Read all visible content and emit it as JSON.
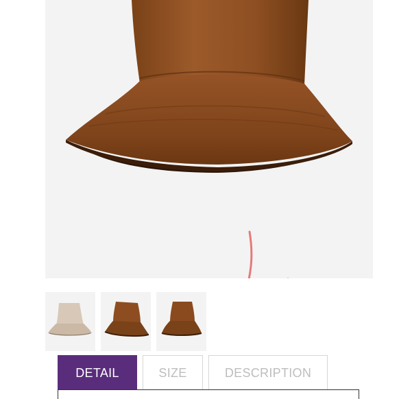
{
  "product": {
    "main_image": "brown-suede-bucket-hat",
    "handwritten_mark": "L",
    "mark_color": "#e57a7a",
    "thumbnails": [
      {
        "icon": "beige-bucket-hat"
      },
      {
        "icon": "brown-suede-bucket-hat"
      },
      {
        "icon": "brown-suede-bucket-hat"
      }
    ]
  },
  "tabs": {
    "detail_label": "DETAIL",
    "size_label": "SIZE",
    "description_label": "DESCRIPTION",
    "active_color": "#5a2d7c"
  }
}
